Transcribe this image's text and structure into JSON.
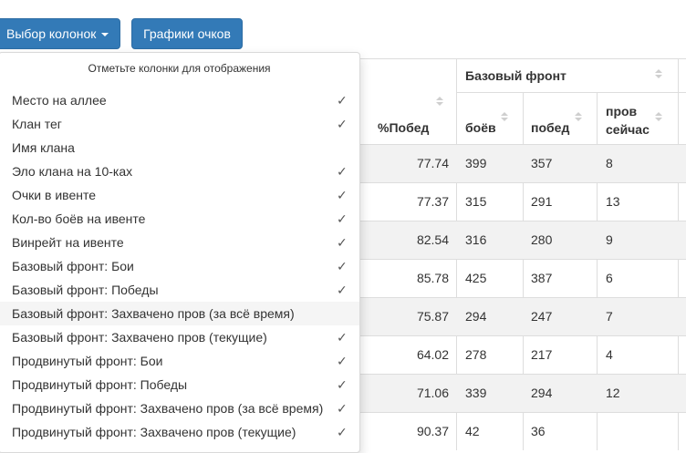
{
  "toolbar": {
    "columns_button": "Выбор колонок",
    "charts_button": "Графики очков"
  },
  "table": {
    "headers": {
      "win_pct": "%Побед",
      "group_base": "Базовый фронт",
      "battles": "боёв",
      "wins": "побед",
      "capt_line1": "пров",
      "capt_line2": "сейчас"
    },
    "rows": [
      {
        "win_pct": "77.74",
        "battles": "399",
        "wins": "357",
        "captured": "8"
      },
      {
        "win_pct": "77.37",
        "battles": "315",
        "wins": "291",
        "captured": "13"
      },
      {
        "win_pct": "82.54",
        "battles": "316",
        "wins": "280",
        "captured": "9"
      },
      {
        "win_pct": "85.78",
        "battles": "425",
        "wins": "387",
        "captured": "6"
      },
      {
        "win_pct": "75.87",
        "battles": "294",
        "wins": "247",
        "captured": "7"
      },
      {
        "win_pct": "64.02",
        "battles": "278",
        "wins": "217",
        "captured": "4"
      },
      {
        "win_pct": "71.06",
        "battles": "339",
        "wins": "294",
        "captured": "12"
      },
      {
        "win_pct": "90.37",
        "battles": "42",
        "wins": "36",
        "captured": ""
      }
    ]
  },
  "column_menu": {
    "header": "Отметьте колонки для отображения",
    "items": [
      {
        "label": "Место на аллее",
        "checked": true
      },
      {
        "label": "Клан тег",
        "checked": true
      },
      {
        "label": "Имя клана",
        "checked": false
      },
      {
        "label": "Эло клана на 10-ках",
        "checked": true
      },
      {
        "label": "Очки в ивенте",
        "checked": true
      },
      {
        "label": "Кол-во боёв на ивенте",
        "checked": true
      },
      {
        "label": "Винрейт на ивенте",
        "checked": true
      },
      {
        "label": "Базовый фронт: Бои",
        "checked": true
      },
      {
        "label": "Базовый фронт: Победы",
        "checked": true
      },
      {
        "label": "Базовый фронт: Захвачено пров (за всё время)",
        "checked": false,
        "hover": true
      },
      {
        "label": "Базовый фронт: Захвачено пров (текущие)",
        "checked": true
      },
      {
        "label": "Продвинутый фронт: Бои",
        "checked": true
      },
      {
        "label": "Продвинутый фронт: Победы",
        "checked": true
      },
      {
        "label": "Продвинутый фронт: Захвачено пров (за всё время)",
        "checked": true
      },
      {
        "label": "Продвинутый фронт: Захвачено пров (текущие)",
        "checked": true
      }
    ],
    "check_glyph": "✓"
  }
}
